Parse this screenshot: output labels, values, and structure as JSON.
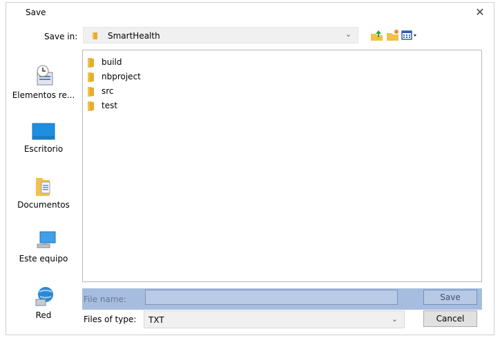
{
  "window": {
    "title": "Save"
  },
  "save_in": {
    "label": "Save in:",
    "value": "SmartHealth",
    "icons": [
      "folder-icon",
      "up-one-level-icon",
      "new-folder-icon",
      "view-menu-icon",
      "chevron-down-icon"
    ]
  },
  "places": [
    {
      "label": "Elementos re...",
      "icon": "recent-items-icon"
    },
    {
      "label": "Escritorio",
      "icon": "desktop-icon"
    },
    {
      "label": "Documentos",
      "icon": "documents-icon"
    },
    {
      "label": "Este equipo",
      "icon": "computer-icon"
    },
    {
      "label": "Red",
      "icon": "network-icon"
    }
  ],
  "files": [
    {
      "name": "build",
      "icon": "folder-icon"
    },
    {
      "name": "nbproject",
      "icon": "folder-icon"
    },
    {
      "name": "src",
      "icon": "folder-icon"
    },
    {
      "name": "test",
      "icon": "folder-icon"
    }
  ],
  "file_name": {
    "label": "File name:",
    "value": ""
  },
  "files_of_type": {
    "label": "Files of type:",
    "value": "TXT"
  },
  "buttons": {
    "save": "Save",
    "cancel": "Cancel"
  },
  "colors": {
    "highlight_row": "#a6bde0",
    "folder": "#f0c14b",
    "desktop": "#1e8fe0"
  }
}
